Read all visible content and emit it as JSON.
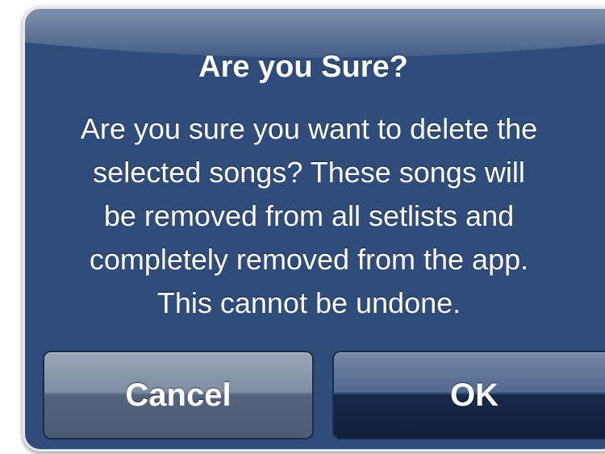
{
  "alert": {
    "title": "Are you Sure?",
    "message_lines": [
      "Are you sure you want to delete the",
      "selected songs? These songs will",
      "be removed from all setlists and",
      "completely removed from the app.",
      "This cannot be undone."
    ],
    "buttons": {
      "cancel": "Cancel",
      "ok": "OK"
    }
  },
  "colors": {
    "alert_background": "#2f4c7a",
    "alert_border": "#e6e9ef",
    "text": "#ffffff"
  }
}
